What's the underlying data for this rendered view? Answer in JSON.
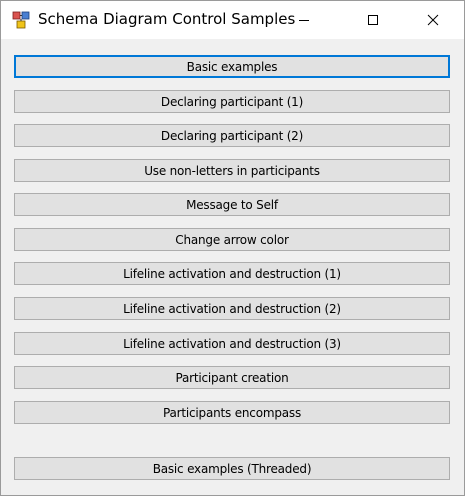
{
  "window": {
    "title": "Schema Diagram Control Samples",
    "controls": {
      "minimize_icon": "minimize-icon",
      "maximize_icon": "maximize-icon",
      "close_icon": "close-icon"
    }
  },
  "buttons": [
    {
      "label": "Basic examples",
      "focused": true
    },
    {
      "label": "Declaring participant (1)"
    },
    {
      "label": "Declaring participant (2)"
    },
    {
      "label": "Use non-letters in participants"
    },
    {
      "label": "Message to Self"
    },
    {
      "label": "Change arrow color"
    },
    {
      "label": "Lifeline activation and destruction (1)"
    },
    {
      "label": "Lifeline activation and destruction (2)"
    },
    {
      "label": "Lifeline activation and destruction (3)"
    },
    {
      "label": "Participant creation"
    },
    {
      "label": "Participants encompass"
    },
    {
      "label": "Basic examples (Threaded)"
    }
  ],
  "colors": {
    "focus_border": "#0078d7",
    "button_face": "#e1e1e1",
    "window_bg": "#f0f0f0"
  }
}
